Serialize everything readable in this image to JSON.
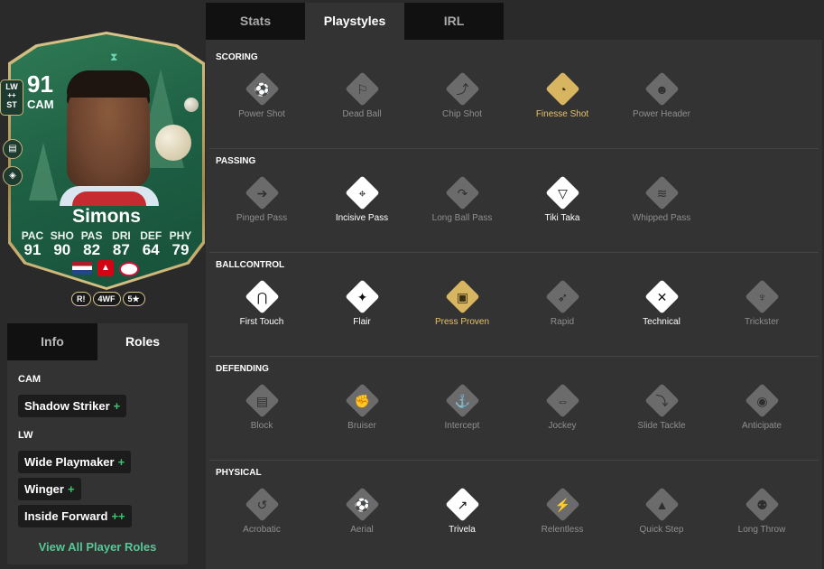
{
  "card": {
    "rating": "91",
    "position": "CAM",
    "alt_positions": [
      "LW",
      "++",
      "ST"
    ],
    "name": "Simons",
    "stat_labels": [
      "PAC",
      "SHO",
      "PAS",
      "DRI",
      "DEF",
      "PHY"
    ],
    "stat_values": [
      "91",
      "90",
      "82",
      "87",
      "64",
      "79"
    ],
    "chips": [
      "R!",
      "4WF",
      "5★"
    ]
  },
  "left_tabs": {
    "info": "Info",
    "roles": "Roles"
  },
  "roles": {
    "groups": [
      {
        "heading": "CAM",
        "items": [
          {
            "name": "Shadow Striker",
            "plus": "+"
          }
        ]
      },
      {
        "heading": "LW",
        "items": [
          {
            "name": "Wide Playmaker",
            "plus": "+"
          },
          {
            "name": "Winger",
            "plus": "+"
          },
          {
            "name": "Inside Forward",
            "plus": "++"
          }
        ]
      }
    ],
    "view_all": "View All Player Roles"
  },
  "tabs": [
    "Stats",
    "Playstyles",
    "IRL"
  ],
  "playstyles": [
    {
      "title": "SCORING",
      "items": [
        {
          "label": "Power Shot",
          "tier": "none",
          "icon": "power-shot-icon",
          "glyph": "⚽"
        },
        {
          "label": "Dead Ball",
          "tier": "none",
          "icon": "dead-ball-icon",
          "glyph": "⚐"
        },
        {
          "label": "Chip Shot",
          "tier": "none",
          "icon": "chip-shot-icon",
          "glyph": "⤴"
        },
        {
          "label": "Finesse Shot",
          "tier": "gold",
          "icon": "finesse-shot-icon",
          "glyph": "◔"
        },
        {
          "label": "Power Header",
          "tier": "none",
          "icon": "power-header-icon",
          "glyph": "☻"
        }
      ]
    },
    {
      "title": "PASSING",
      "items": [
        {
          "label": "Pinged Pass",
          "tier": "none",
          "icon": "pinged-pass-icon",
          "glyph": "➔"
        },
        {
          "label": "Incisive Pass",
          "tier": "plus",
          "icon": "incisive-pass-icon",
          "glyph": "⌖"
        },
        {
          "label": "Long Ball Pass",
          "tier": "none",
          "icon": "long-ball-pass-icon",
          "glyph": "↷"
        },
        {
          "label": "Tiki Taka",
          "tier": "plus",
          "icon": "tiki-taka-icon",
          "glyph": "▽"
        },
        {
          "label": "Whipped Pass",
          "tier": "none",
          "icon": "whipped-pass-icon",
          "glyph": "≋"
        }
      ]
    },
    {
      "title": "BALLCONTROL",
      "items": [
        {
          "label": "First Touch",
          "tier": "plus",
          "icon": "first-touch-icon",
          "glyph": "⋂"
        },
        {
          "label": "Flair",
          "tier": "plus",
          "icon": "flair-icon",
          "glyph": "✦"
        },
        {
          "label": "Press Proven",
          "tier": "gold",
          "icon": "press-proven-icon",
          "glyph": "▣"
        },
        {
          "label": "Rapid",
          "tier": "none",
          "icon": "rapid-icon",
          "glyph": "➶"
        },
        {
          "label": "Technical",
          "tier": "plus",
          "icon": "technical-icon",
          "glyph": "✕"
        },
        {
          "label": "Trickster",
          "tier": "none",
          "icon": "trickster-icon",
          "glyph": "♆"
        }
      ]
    },
    {
      "title": "DEFENDING",
      "items": [
        {
          "label": "Block",
          "tier": "none",
          "icon": "block-icon",
          "glyph": "▤"
        },
        {
          "label": "Bruiser",
          "tier": "none",
          "icon": "bruiser-icon",
          "glyph": "✊"
        },
        {
          "label": "Intercept",
          "tier": "none",
          "icon": "intercept-icon",
          "glyph": "⚓"
        },
        {
          "label": "Jockey",
          "tier": "none",
          "icon": "jockey-icon",
          "glyph": "⇔"
        },
        {
          "label": "Slide Tackle",
          "tier": "none",
          "icon": "slide-tackle-icon",
          "glyph": "⤵"
        },
        {
          "label": "Anticipate",
          "tier": "none",
          "icon": "anticipate-icon",
          "glyph": "◉"
        }
      ]
    },
    {
      "title": "PHYSICAL",
      "items": [
        {
          "label": "Acrobatic",
          "tier": "none",
          "icon": "acrobatic-icon",
          "glyph": "↺"
        },
        {
          "label": "Aerial",
          "tier": "none",
          "icon": "aerial-icon",
          "glyph": "⚽"
        },
        {
          "label": "Trivela",
          "tier": "plus",
          "icon": "trivela-icon",
          "glyph": "↗"
        },
        {
          "label": "Relentless",
          "tier": "none",
          "icon": "relentless-icon",
          "glyph": "⚡"
        },
        {
          "label": "Quick Step",
          "tier": "none",
          "icon": "quick-step-icon",
          "glyph": "▲"
        },
        {
          "label": "Long Throw",
          "tier": "none",
          "icon": "long-throw-icon",
          "glyph": "⚉"
        }
      ]
    }
  ]
}
